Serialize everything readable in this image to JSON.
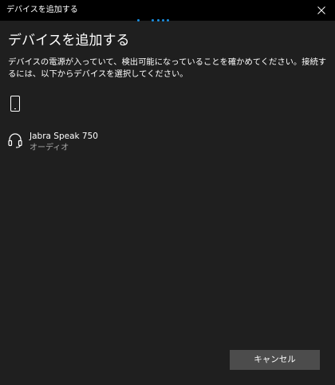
{
  "window": {
    "title": "デバイスを追加する"
  },
  "header": {
    "heading": "デバイスを追加する",
    "instructions": "デバイスの電源が入っていて、検出可能になっていることを確かめてください。接続するには、以下からデバイスを選択してください。"
  },
  "devices": [
    {
      "name": "Jabra Speak 750",
      "type": "オーディオ",
      "icon": "headset-icon"
    }
  ],
  "buttons": {
    "cancel": "キャンセル"
  },
  "icons": {
    "close": "close-icon",
    "phone": "phone-icon"
  },
  "colors": {
    "background": "#1f1f1f",
    "titlebar": "#000000",
    "accent": "#1a8fe0",
    "button": "#4c4c4c",
    "secondary_text": "#a8a8a8"
  }
}
